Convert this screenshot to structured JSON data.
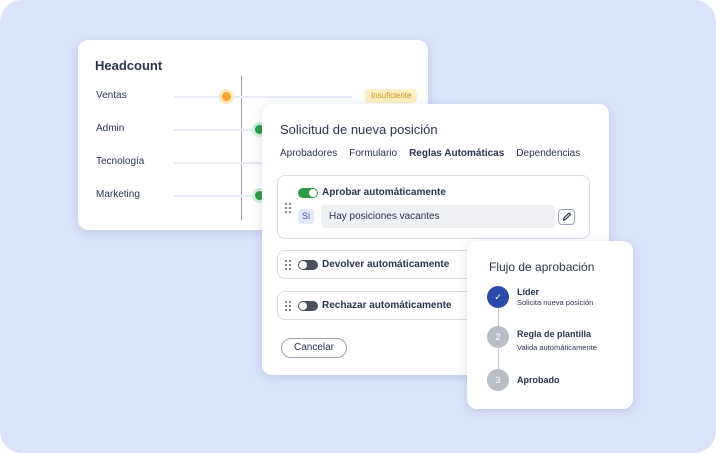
{
  "headcount": {
    "title": "Headcount",
    "rows": [
      {
        "label": "Ventas",
        "status": "orange",
        "badge": "Insuficiente"
      },
      {
        "label": "Admin",
        "status": "green"
      },
      {
        "label": "Tecnología",
        "status": "none"
      },
      {
        "label": "Marketing",
        "status": "green"
      }
    ]
  },
  "solicitud": {
    "title": "Solicitud de nueva posición",
    "tabs": [
      {
        "label": "Aprobadores",
        "active": false
      },
      {
        "label": "Formulario",
        "active": false
      },
      {
        "label": "Reglas Automáticas",
        "active": true
      },
      {
        "label": "Dependencias",
        "active": false
      }
    ],
    "rules": [
      {
        "label": "Aprobar automáticamente",
        "enabled": true,
        "condition_prefix": "Si",
        "condition": "Hay posiciones vacantes"
      },
      {
        "label": "Devolver automáticamente",
        "enabled": false
      },
      {
        "label": "Rechazar automáticamente",
        "enabled": false
      }
    ],
    "cancel_label": "Cancelar"
  },
  "flujo": {
    "title": "Flujo de aprobación",
    "steps": [
      {
        "marker": "✓",
        "title": "Líder",
        "subtitle": "Solicita nueva posición",
        "state": "done"
      },
      {
        "marker": "2",
        "title": "Regla de plantilla",
        "subtitle": "Valida automáticamente",
        "state": "pending"
      },
      {
        "marker": "3",
        "title": "Aprobado",
        "subtitle": "",
        "state": "pending"
      }
    ]
  },
  "colors": {
    "background": "#dbe3fb",
    "accent": "#2c4ba8",
    "success": "#2f9a48",
    "warning": "#f4a72a",
    "badge_bg": "#fdf0c2"
  }
}
